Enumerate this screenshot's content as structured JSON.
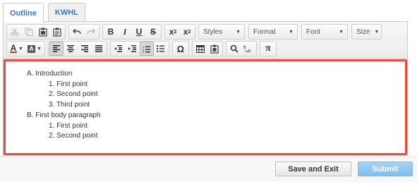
{
  "tabs": [
    {
      "label": "Outline",
      "active": true
    },
    {
      "label": "KWHL",
      "active": false
    }
  ],
  "toolbar": {
    "row1": {
      "cut_icon": "scissors-icon",
      "copy_icon": "copy-icon",
      "paste_icon": "paste-icon",
      "paste_text_icon": "paste-text-icon",
      "undo_icon": "undo-icon",
      "redo_icon": "redo-icon",
      "bold": "B",
      "italic": "I",
      "underline": "U",
      "strike": "S",
      "subscript": "x",
      "subscript_mark": "2",
      "superscript": "x",
      "superscript_mark": "2",
      "styles_label": "Styles",
      "format_label": "Format",
      "font_label": "Font",
      "size_label": "Size"
    },
    "row2": {
      "text_color": "A",
      "bg_color": "A",
      "special_char": "Ω",
      "pi": "π"
    }
  },
  "outline": [
    {
      "level": 1,
      "marker": "A.",
      "text": "Introduction"
    },
    {
      "level": 2,
      "marker": "1.",
      "text": "First point"
    },
    {
      "level": 2,
      "marker": "2.",
      "text": "Second point"
    },
    {
      "level": 2,
      "marker": "3.",
      "text": "Third point"
    },
    {
      "level": 1,
      "marker": "B.",
      "text": "First body paragraph"
    },
    {
      "level": 2,
      "marker": "1.",
      "text": "First point"
    },
    {
      "level": 2,
      "marker": "2.",
      "text": "Second point"
    }
  ],
  "buttons": {
    "save_exit": "Save and Exit",
    "submit": "Submit"
  },
  "colors": {
    "tab_text": "#3a78c4",
    "content_border": "#e74c3c",
    "submit_bg": "#8cc4f0"
  }
}
